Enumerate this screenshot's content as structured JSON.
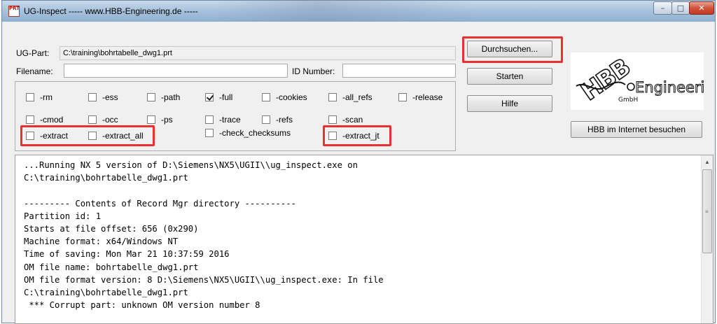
{
  "window": {
    "title": "UG-Inspect ----- www.HBB-Engineering.de -----",
    "icon_text": "PRT",
    "controls": {
      "minimize": "–",
      "maximize": "□",
      "close": "✕"
    }
  },
  "form": {
    "ugpart_label": "UG-Part:",
    "ugpart_value": "C:\\training\\bohrtabelle_dwg1.prt",
    "filename_label": "Filename:",
    "filename_value": "",
    "idnumber_label": "ID Number:",
    "idnumber_value": ""
  },
  "options": [
    {
      "label": "-rm",
      "checked": false,
      "highlighted": false
    },
    {
      "label": "-ess",
      "checked": false,
      "highlighted": false
    },
    {
      "label": "-path",
      "checked": false,
      "highlighted": false
    },
    {
      "label": "-full",
      "checked": true,
      "highlighted": false
    },
    {
      "label": "-cookies",
      "checked": false,
      "highlighted": false
    },
    {
      "label": "-all_refs",
      "checked": false,
      "highlighted": false
    },
    {
      "label": "-release",
      "checked": false,
      "highlighted": false
    },
    {
      "label": "-cmod",
      "checked": false,
      "highlighted": false
    },
    {
      "label": "-occ",
      "checked": false,
      "highlighted": false
    },
    {
      "label": "-ps",
      "checked": false,
      "highlighted": false
    },
    {
      "label": "-trace",
      "checked": false,
      "highlighted": false
    },
    {
      "label": "-refs",
      "checked": false,
      "highlighted": false
    },
    {
      "label": "-scan",
      "checked": false,
      "highlighted": false
    },
    {
      "label": "-extract",
      "checked": false,
      "highlighted": true
    },
    {
      "label": "-extract_all",
      "checked": false,
      "highlighted": true
    },
    {
      "label": "-check_checksums",
      "checked": false,
      "highlighted": false
    },
    {
      "label": "-extract_jt",
      "checked": false,
      "highlighted": true
    }
  ],
  "buttons": {
    "browse": "Durchsuchen...",
    "start": "Starten",
    "help": "Hilfe",
    "website": "HBB im Internet besuchen"
  },
  "logo": {
    "brand": "HBB",
    "text": "Engineering",
    "suffix": "GmbH"
  },
  "highlight_color": "#e8322f",
  "output_lines": [
    "...Running NX 5 version of D:\\Siemens\\NX5\\UGII\\\\ug_inspect.exe on",
    "C:\\training\\bohrtabelle_dwg1.prt",
    "",
    "--------- Contents of Record Mgr directory ----------",
    "Partition id: 1",
    "Starts at file offset: 656 (0x290)",
    "Machine format: x64/Windows NT",
    "Time of saving: Mon Mar 21 10:37:59 2016",
    "OM file name: bohrtabelle_dwg1.prt",
    "OM file format version: 8 D:\\Siemens\\NX5\\UGII\\\\ug_inspect.exe: In file",
    "C:\\training\\bohrtabelle_dwg1.prt",
    " *** Corrupt part: unknown OM version number 8"
  ]
}
